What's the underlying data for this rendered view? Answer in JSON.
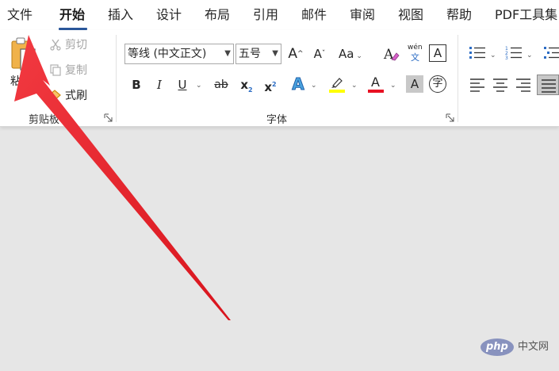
{
  "menu_tabs": [
    {
      "label": "文件",
      "active": false
    },
    {
      "label": "开始",
      "active": true
    },
    {
      "label": "插入",
      "active": false
    },
    {
      "label": "设计",
      "active": false
    },
    {
      "label": "布局",
      "active": false
    },
    {
      "label": "引用",
      "active": false
    },
    {
      "label": "邮件",
      "active": false
    },
    {
      "label": "审阅",
      "active": false
    },
    {
      "label": "视图",
      "active": false
    },
    {
      "label": "帮助",
      "active": false
    },
    {
      "label": "PDF工具集",
      "active": false
    }
  ],
  "clipboard": {
    "paste_label": "粘贴",
    "cut_label": "剪切",
    "copy_label": "复制",
    "format_painter_label": "式刷",
    "group_label": "剪贴板"
  },
  "font": {
    "font_name": "等线 (中文正文)",
    "font_size": "五号",
    "grow_label": "A",
    "shrink_label": "A",
    "change_case_label": "Aa",
    "pinyin_top": "wén",
    "pinyin_bottom": "文",
    "char_border_label": "A",
    "bold_label": "B",
    "italic_label": "I",
    "underline_label": "U",
    "strike_label": "ab",
    "subscript_label": "x",
    "subscript_sub": "2",
    "superscript_label": "x",
    "superscript_sup": "2",
    "text_effect_label": "A",
    "font_color_label": "A",
    "char_shading_label": "A",
    "enclose_label": "字",
    "group_label": "字体",
    "highlight_color": "#ffff00",
    "font_color": "#e81123"
  },
  "watermark": {
    "brand": "php",
    "site": "中文网"
  },
  "colors": {
    "accent": "#2b579a",
    "arrow": "#e8202a"
  }
}
